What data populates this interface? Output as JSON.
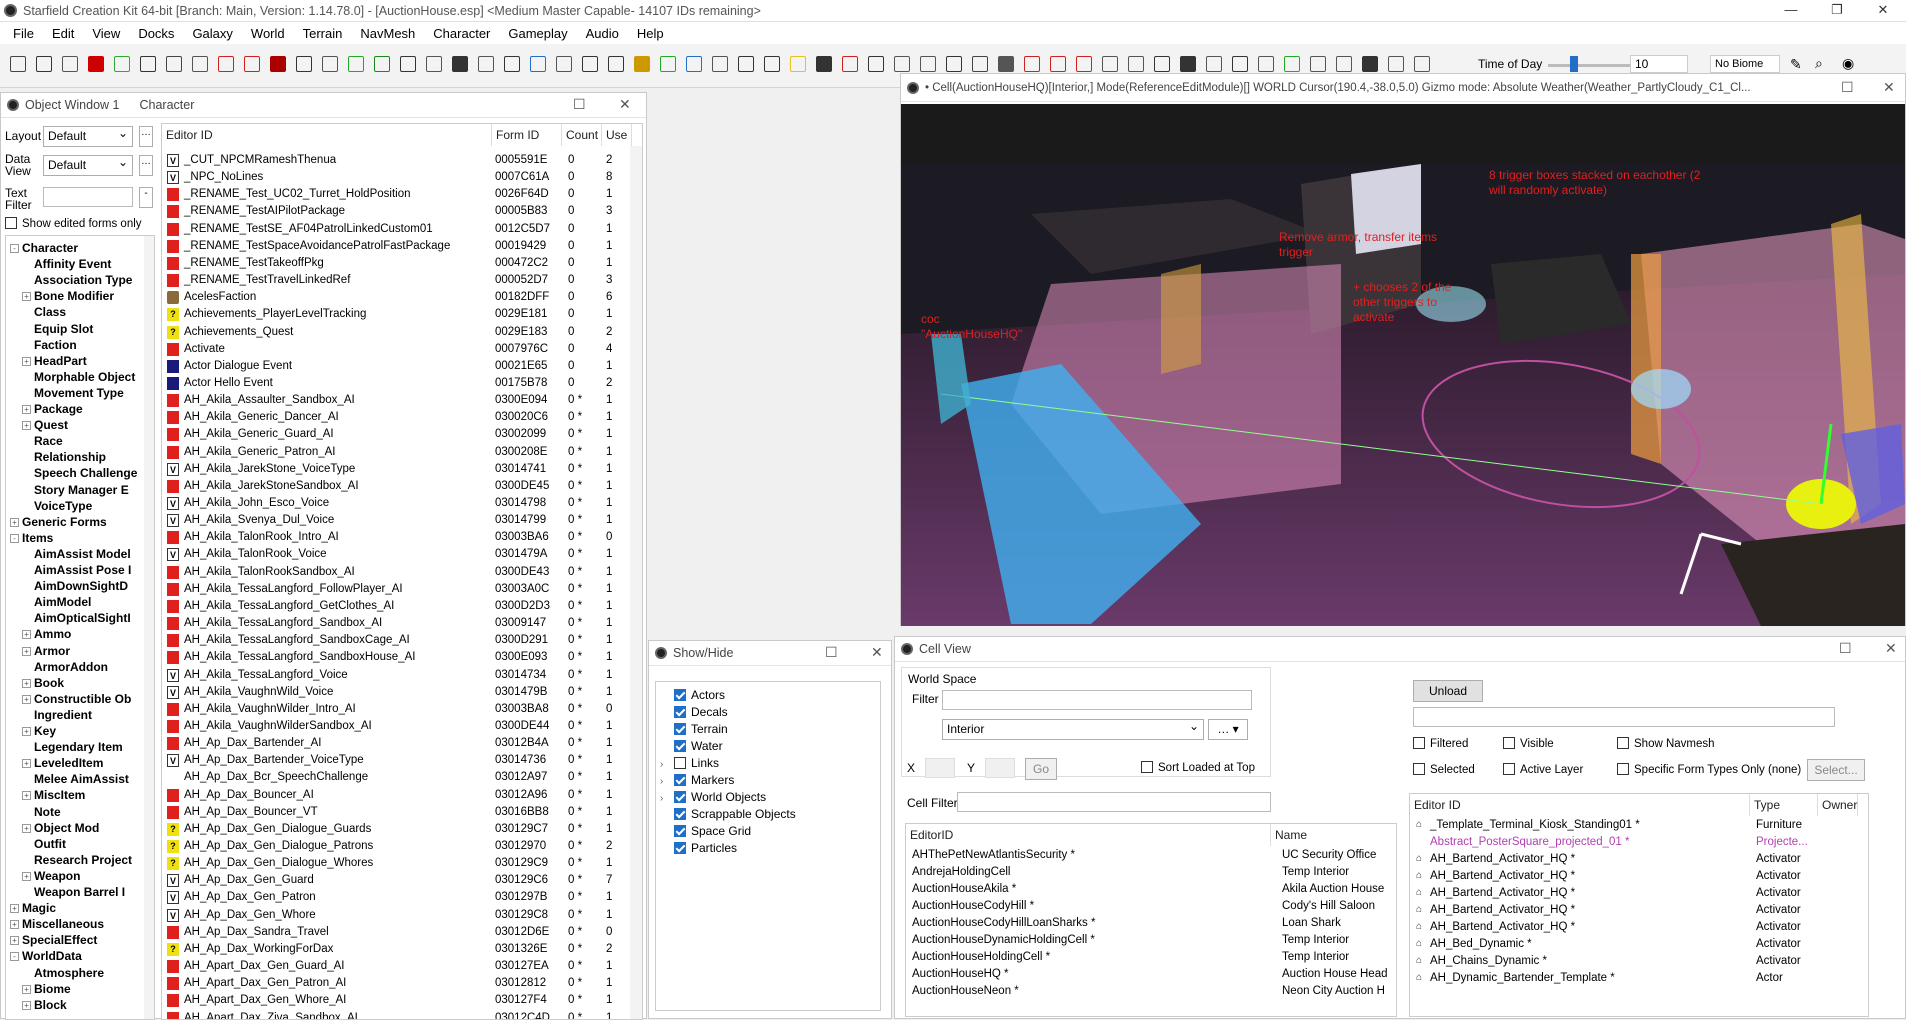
{
  "window_title": "Starfield Creation Kit 64-bit [Branch: Main, Version: 1.14.78.0] - [AuctionHouse.esp] <Medium Master Capable- 14107 IDs remaining>",
  "menu": [
    "File",
    "Edit",
    "View",
    "Docks",
    "Galaxy",
    "World",
    "Terrain",
    "NavMesh",
    "Character",
    "Gameplay",
    "Audio",
    "Help"
  ],
  "toolbar": {
    "time_of_day_label": "Time of Day",
    "time_value": "10",
    "biome": "No Biome"
  },
  "object_window": {
    "title": "Object Window 1",
    "subtitle": "Character",
    "layout_label": "Layout",
    "layout_value": "Default",
    "data_view_label": "Data View",
    "data_view_value": "Default",
    "text_filter_label": "Text Filter",
    "show_edited_label": "Show edited forms only",
    "tree": [
      {
        "label": "Character",
        "level": 0,
        "exp": "-"
      },
      {
        "label": "Affinity Event",
        "level": 1
      },
      {
        "label": "Association Type",
        "level": 1
      },
      {
        "label": "Bone Modifier",
        "level": 1,
        "exp": "+"
      },
      {
        "label": "Class",
        "level": 1
      },
      {
        "label": "Equip Slot",
        "level": 1
      },
      {
        "label": "Faction",
        "level": 1
      },
      {
        "label": "HeadPart",
        "level": 1,
        "exp": "+"
      },
      {
        "label": "Morphable Object",
        "level": 1
      },
      {
        "label": "Movement Type",
        "level": 1
      },
      {
        "label": "Package",
        "level": 1,
        "exp": "+"
      },
      {
        "label": "Quest",
        "level": 1,
        "exp": "+"
      },
      {
        "label": "Race",
        "level": 1
      },
      {
        "label": "Relationship",
        "level": 1
      },
      {
        "label": "Speech Challenge",
        "level": 1
      },
      {
        "label": "Story Manager E",
        "level": 1
      },
      {
        "label": "VoiceType",
        "level": 1
      },
      {
        "label": "Generic Forms",
        "level": 0,
        "exp": "+"
      },
      {
        "label": "Items",
        "level": 0,
        "exp": "-"
      },
      {
        "label": "AimAssist Model",
        "level": 1
      },
      {
        "label": "AimAssist Pose I",
        "level": 1
      },
      {
        "label": "AimDownSightD",
        "level": 1
      },
      {
        "label": "AimModel",
        "level": 1
      },
      {
        "label": "AimOpticalSightI",
        "level": 1
      },
      {
        "label": "Ammo",
        "level": 1,
        "exp": "+"
      },
      {
        "label": "Armor",
        "level": 1,
        "exp": "+"
      },
      {
        "label": "ArmorAddon",
        "level": 1
      },
      {
        "label": "Book",
        "level": 1,
        "exp": "+"
      },
      {
        "label": "Constructible Ob",
        "level": 1,
        "exp": "+"
      },
      {
        "label": "Ingredient",
        "level": 1
      },
      {
        "label": "Key",
        "level": 1,
        "exp": "+"
      },
      {
        "label": "Legendary Item",
        "level": 1
      },
      {
        "label": "LeveledItem",
        "level": 1,
        "exp": "+"
      },
      {
        "label": "Melee AimAssist",
        "level": 1
      },
      {
        "label": "MiscItem",
        "level": 1,
        "exp": "+"
      },
      {
        "label": "Note",
        "level": 1
      },
      {
        "label": "Object Mod",
        "level": 1,
        "exp": "+"
      },
      {
        "label": "Outfit",
        "level": 1
      },
      {
        "label": "Research Project",
        "level": 1
      },
      {
        "label": "Weapon",
        "level": 1,
        "exp": "+"
      },
      {
        "label": "Weapon Barrel I",
        "level": 1
      },
      {
        "label": "Magic",
        "level": 0,
        "exp": "+"
      },
      {
        "label": "Miscellaneous",
        "level": 0,
        "exp": "+"
      },
      {
        "label": "SpecialEffect",
        "level": 0,
        "exp": "+"
      },
      {
        "label": "WorldData",
        "level": 0,
        "exp": "-"
      },
      {
        "label": "Atmosphere",
        "level": 1
      },
      {
        "label": "Biome",
        "level": 1,
        "exp": "+"
      },
      {
        "label": "Block",
        "level": 1,
        "exp": "+"
      }
    ],
    "columns": [
      "Editor ID",
      "Form ID",
      "Count",
      "Use"
    ],
    "rows": [
      {
        "icon": "v",
        "id": "_CUT_NPCMRameshThenua",
        "form": "0005591E",
        "count": "0",
        "use": "2"
      },
      {
        "icon": "v",
        "id": "_NPC_NoLines",
        "form": "0007C61A",
        "count": "0",
        "use": "8"
      },
      {
        "icon": "red",
        "id": "_RENAME_Test_UC02_Turret_HoldPosition",
        "form": "0026F64D",
        "count": "0",
        "use": "1"
      },
      {
        "icon": "red",
        "id": "_RENAME_TestAIPilotPackage",
        "form": "00005B83",
        "count": "0",
        "use": "3"
      },
      {
        "icon": "red",
        "id": "_RENAME_TestSE_AF04PatrolLinkedCustom01",
        "form": "0012C5D7",
        "count": "0",
        "use": "1"
      },
      {
        "icon": "red",
        "id": "_RENAME_TestSpaceAvoidancePatrolFastPackage",
        "form": "00019429",
        "count": "0",
        "use": "1"
      },
      {
        "icon": "red",
        "id": "_RENAME_TestTakeoffPkg",
        "form": "000472C2",
        "count": "0",
        "use": "1"
      },
      {
        "icon": "red",
        "id": "_RENAME_TestTravelLinkedRef",
        "form": "000052D7",
        "count": "0",
        "use": "3"
      },
      {
        "icon": "fac",
        "id": "AcelesFaction",
        "form": "00182DFF",
        "count": "0",
        "use": "6"
      },
      {
        "icon": "q",
        "id": "Achievements_PlayerLevelTracking",
        "form": "0029E181",
        "count": "0",
        "use": "1"
      },
      {
        "icon": "q",
        "id": "Achievements_Quest",
        "form": "0029E183",
        "count": "0",
        "use": "2"
      },
      {
        "icon": "red",
        "id": "Activate",
        "form": "0007976C",
        "count": "0",
        "use": "4"
      },
      {
        "icon": "blue",
        "id": "Actor Dialogue Event",
        "form": "00021E65",
        "count": "0",
        "use": "1"
      },
      {
        "icon": "blue",
        "id": "Actor Hello Event",
        "form": "00175B78",
        "count": "0",
        "use": "2"
      },
      {
        "icon": "red",
        "id": "AH_Akila_Assaulter_Sandbox_AI",
        "form": "0300E094",
        "count": "0 *",
        "use": "1"
      },
      {
        "icon": "red",
        "id": "AH_Akila_Generic_Dancer_AI",
        "form": "030020C6",
        "count": "0 *",
        "use": "1"
      },
      {
        "icon": "red",
        "id": "AH_Akila_Generic_Guard_AI",
        "form": "03002099",
        "count": "0 *",
        "use": "1"
      },
      {
        "icon": "red",
        "id": "AH_Akila_Generic_Patron_AI",
        "form": "0300208E",
        "count": "0 *",
        "use": "1"
      },
      {
        "icon": "v",
        "id": "AH_Akila_JarekStone_VoiceType",
        "form": "03014741",
        "count": "0 *",
        "use": "1"
      },
      {
        "icon": "red",
        "id": "AH_Akila_JarekStoneSandbox_AI",
        "form": "0300DE45",
        "count": "0 *",
        "use": "1"
      },
      {
        "icon": "v",
        "id": "AH_Akila_John_Esco_Voice",
        "form": "03014798",
        "count": "0 *",
        "use": "1"
      },
      {
        "icon": "v",
        "id": "AH_Akila_Svenya_Dul_Voice",
        "form": "03014799",
        "count": "0 *",
        "use": "1"
      },
      {
        "icon": "red",
        "id": "AH_Akila_TalonRook_Intro_AI",
        "form": "03003BA6",
        "count": "0 *",
        "use": "0"
      },
      {
        "icon": "v",
        "id": "AH_Akila_TalonRook_Voice",
        "form": "0301479A",
        "count": "0 *",
        "use": "1"
      },
      {
        "icon": "red",
        "id": "AH_Akila_TalonRookSandbox_AI",
        "form": "0300DE43",
        "count": "0 *",
        "use": "1"
      },
      {
        "icon": "red",
        "id": "AH_Akila_TessaLangford_FollowPlayer_AI",
        "form": "03003A0C",
        "count": "0 *",
        "use": "1"
      },
      {
        "icon": "red",
        "id": "AH_Akila_TessaLangford_GetClothes_AI",
        "form": "0300D2D3",
        "count": "0 *",
        "use": "1"
      },
      {
        "icon": "red",
        "id": "AH_Akila_TessaLangford_Sandbox_AI",
        "form": "03009147",
        "count": "0 *",
        "use": "1"
      },
      {
        "icon": "red",
        "id": "AH_Akila_TessaLangford_SandboxCage_AI",
        "form": "0300D291",
        "count": "0 *",
        "use": "1"
      },
      {
        "icon": "red",
        "id": "AH_Akila_TessaLangford_SandboxHouse_AI",
        "form": "0300E093",
        "count": "0 *",
        "use": "1"
      },
      {
        "icon": "v",
        "id": "AH_Akila_TessaLangford_Voice",
        "form": "03014734",
        "count": "0 *",
        "use": "1"
      },
      {
        "icon": "v",
        "id": "AH_Akila_VaughnWild_Voice",
        "form": "0301479B",
        "count": "0 *",
        "use": "1"
      },
      {
        "icon": "red",
        "id": "AH_Akila_VaughnWilder_Intro_AI",
        "form": "03003BA8",
        "count": "0 *",
        "use": "0"
      },
      {
        "icon": "red",
        "id": "AH_Akila_VaughnWilderSandbox_AI",
        "form": "0300DE44",
        "count": "0 *",
        "use": "1"
      },
      {
        "icon": "red",
        "id": "AH_Ap_Dax_Bartender_AI",
        "form": "03012B4A",
        "count": "0 *",
        "use": "1"
      },
      {
        "icon": "v",
        "id": "AH_Ap_Dax_Bartender_VoiceType",
        "form": "03014736",
        "count": "0 *",
        "use": "1"
      },
      {
        "icon": "none",
        "id": "AH_Ap_Dax_Bcr_SpeechChallenge",
        "form": "03012A97",
        "count": "0 *",
        "use": "1"
      },
      {
        "icon": "red",
        "id": "AH_Ap_Dax_Bouncer_AI",
        "form": "03012A96",
        "count": "0 *",
        "use": "1"
      },
      {
        "icon": "red",
        "id": "AH_Ap_Dax_Bouncer_VT",
        "form": "03016BB8",
        "count": "0 *",
        "use": "1"
      },
      {
        "icon": "q",
        "id": "AH_Ap_Dax_Gen_Dialogue_Guards",
        "form": "030129C7",
        "count": "0 *",
        "use": "1"
      },
      {
        "icon": "q",
        "id": "AH_Ap_Dax_Gen_Dialogue_Patrons",
        "form": "03012970",
        "count": "0 *",
        "use": "2"
      },
      {
        "icon": "q",
        "id": "AH_Ap_Dax_Gen_Dialogue_Whores",
        "form": "030129C9",
        "count": "0 *",
        "use": "1"
      },
      {
        "icon": "v",
        "id": "AH_Ap_Dax_Gen_Guard",
        "form": "030129C6",
        "count": "0 *",
        "use": "7"
      },
      {
        "icon": "v",
        "id": "AH_Ap_Dax_Gen_Patron",
        "form": "0301297B",
        "count": "0 *",
        "use": "1"
      },
      {
        "icon": "v",
        "id": "AH_Ap_Dax_Gen_Whore",
        "form": "030129C8",
        "count": "0 *",
        "use": "1"
      },
      {
        "icon": "red",
        "id": "AH_Ap_Dax_Sandra_Travel",
        "form": "03012D6E",
        "count": "0 *",
        "use": "0"
      },
      {
        "icon": "q",
        "id": "AH_Ap_Dax_WorkingForDax",
        "form": "0301326E",
        "count": "0 *",
        "use": "2"
      },
      {
        "icon": "red",
        "id": "AH_Apart_Dax_Gen_Guard_AI",
        "form": "030127EA",
        "count": "0 *",
        "use": "1"
      },
      {
        "icon": "red",
        "id": "AH_Apart_Dax_Gen_Patron_AI",
        "form": "03012812",
        "count": "0 *",
        "use": "1"
      },
      {
        "icon": "red",
        "id": "AH_Apart_Dax_Gen_Whore_AI",
        "form": "030127F4",
        "count": "0 *",
        "use": "1"
      },
      {
        "icon": "red",
        "id": "AH_Apart_Dax_Ziva_Sandbox_AI",
        "form": "03012C4D",
        "count": "0 *",
        "use": "1"
      }
    ]
  },
  "render_window": {
    "title": "• Cell(AuctionHouseHQ)[Interior,] Mode(ReferenceEditModule)[] WORLD  Cursor(190.4,-38.0,5.0)  Gizmo mode: Absolute Weather(Weather_PartlyCloudy_C1_Cl...",
    "annotations": [
      "8 trigger boxes stacked on eachother (2 will randomly activate)",
      "Remove armor, transfer items trigger",
      "+ chooses 2 of the other triggers to activate",
      "coc \"AuctionHouseHQ\""
    ]
  },
  "show_hide": {
    "title": "Show/Hide",
    "items": [
      {
        "label": "Actors",
        "checked": true,
        "exp": false
      },
      {
        "label": "Decals",
        "checked": true,
        "exp": false
      },
      {
        "label": "Terrain",
        "checked": true,
        "exp": false
      },
      {
        "label": "Water",
        "checked": true,
        "exp": false
      },
      {
        "label": "Links",
        "checked": false,
        "exp": true
      },
      {
        "label": "Markers",
        "checked": true,
        "exp": true
      },
      {
        "label": "World Objects",
        "checked": true,
        "exp": true
      },
      {
        "label": "Scrappable Objects",
        "checked": true,
        "exp": false
      },
      {
        "label": "Space Grid",
        "checked": true,
        "exp": false
      },
      {
        "label": "Particles",
        "checked": true,
        "exp": false
      }
    ]
  },
  "cell_view": {
    "title": "Cell View",
    "world_space_label": "World Space",
    "filter_label": "Filter",
    "world_space_value": "Interior",
    "x_label": "X",
    "y_label": "Y",
    "go_label": "Go",
    "sort_loaded_label": "Sort Loaded at Top",
    "cell_filter_label": "Cell Filter",
    "cell_columns": [
      "EditorID",
      "Name"
    ],
    "cells": [
      {
        "id": "AHThePetNewAtlantisSecurity *",
        "name": "UC Security Office"
      },
      {
        "id": "AndrejaHoldingCell",
        "name": "Temp Interior"
      },
      {
        "id": "AuctionHouseAkila *",
        "name": "Akila Auction House"
      },
      {
        "id": "AuctionHouseCodyHill *",
        "name": "Cody's Hill Saloon"
      },
      {
        "id": "AuctionHouseCodyHillLoanSharks *",
        "name": "Loan Shark"
      },
      {
        "id": "AuctionHouseDynamicHoldingCell *",
        "name": "Temp Interior"
      },
      {
        "id": "AuctionHouseHoldingCell *",
        "name": "Temp Interior"
      },
      {
        "id": "AuctionHouseHQ *",
        "name": "Auction House Head"
      },
      {
        "id": "AuctionHouseNeon *",
        "name": "Neon City Auction H"
      }
    ],
    "unload_label": "Unload",
    "filtered_label": "Filtered",
    "visible_label": "Visible",
    "show_navmesh_label": "Show Navmesh",
    "selected_label": "Selected",
    "active_layer_label": "Active Layer",
    "specific_types_label": "Specific Form Types Only (none)",
    "select_btn": "Select...",
    "ref_columns": [
      "Editor ID",
      "Type",
      "Owner"
    ],
    "refs": [
      {
        "id": "_Template_Terminal_Kiosk_Standing01 *",
        "type": "Furniture",
        "pink": false
      },
      {
        "id": "Abstract_PosterSquare_projected_01 *",
        "type": "Projecte...",
        "pink": true
      },
      {
        "id": "AH_Bartend_Activator_HQ *",
        "type": "Activator",
        "pink": false
      },
      {
        "id": "AH_Bartend_Activator_HQ *",
        "type": "Activator",
        "pink": false
      },
      {
        "id": "AH_Bartend_Activator_HQ *",
        "type": "Activator",
        "pink": false
      },
      {
        "id": "AH_Bartend_Activator_HQ *",
        "type": "Activator",
        "pink": false
      },
      {
        "id": "AH_Bartend_Activator_HQ *",
        "type": "Activator",
        "pink": false
      },
      {
        "id": "AH_Bed_Dynamic *",
        "type": "Activator",
        "pink": false
      },
      {
        "id": "AH_Chains_Dynamic *",
        "type": "Activator",
        "pink": false
      },
      {
        "id": "AH_Dynamic_Bartender_Template *",
        "type": "Actor",
        "pink": false
      }
    ]
  }
}
